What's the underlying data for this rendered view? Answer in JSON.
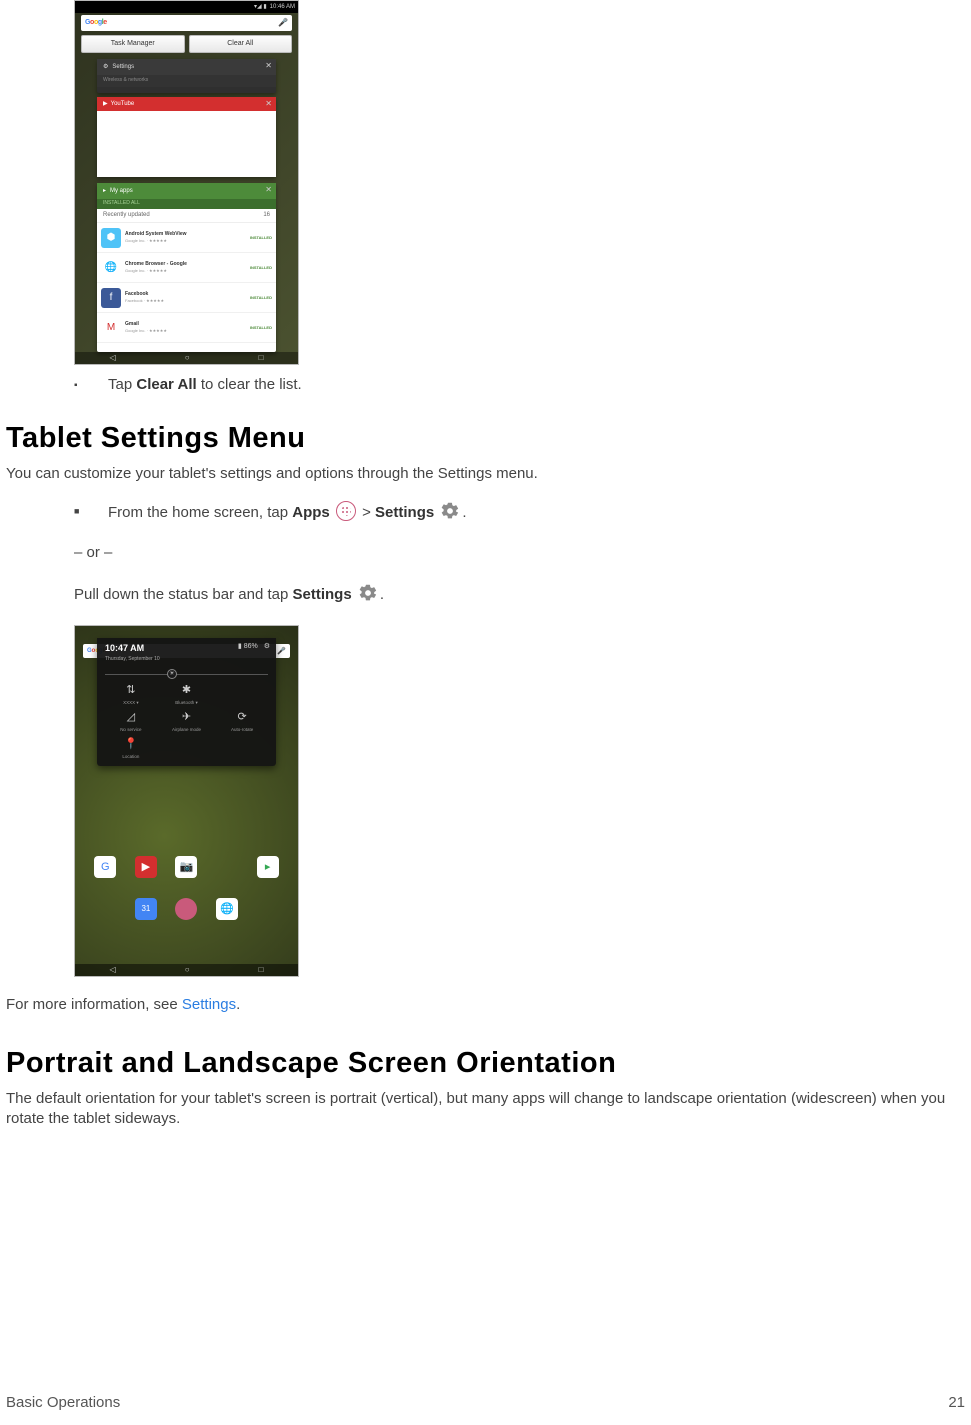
{
  "shot1": {
    "status_time": "10:46 AM",
    "status_signal": "▾◢ ▮",
    "btn_task_manager": "Task Manager",
    "btn_clear_all": "Clear All",
    "settings_label": "Settings",
    "settings_sub": "Wireless & networks",
    "youtube_label": "YouTube",
    "myapps_label": "My apps",
    "myapps_tab": "INSTALLED    ALL",
    "section_label": "Recently updated",
    "section_count": "16",
    "apps": [
      {
        "name": "Android System WebView",
        "meta": "Google Inc. · ★★★★★",
        "btn": "INSTALLED"
      },
      {
        "name": "Chrome Browser - Google",
        "meta": "Google Inc. · ★★★★★",
        "btn": "INSTALLED"
      },
      {
        "name": "Facebook",
        "meta": "Facebook · ★★★★★",
        "btn": "INSTALLED"
      },
      {
        "name": "Gmail",
        "meta": "Google Inc. · ★★★★★",
        "btn": "INSTALLED"
      }
    ]
  },
  "bullet1_pre": "Tap ",
  "bullet1_bold": "Clear All",
  "bullet1_post": " to clear the list.",
  "h1": "Tablet Settings Menu",
  "p1": "You can customize your tablet's settings and options through the Settings menu.",
  "bullet2": {
    "pre": "From the home screen, tap ",
    "apps": "Apps",
    "gt": " > ",
    "settings": "Settings",
    "post": "."
  },
  "or_line": "– or –",
  "pull_line_pre": "Pull down the status bar and tap ",
  "pull_line_bold": "Settings",
  "pull_line_post": ".",
  "shot2": {
    "time": "10:47 AM",
    "date": "Thursday, September 10",
    "battery_pct": "▮ 86%",
    "tiles": [
      {
        "icon": "⇅",
        "label": "XXXX ▾"
      },
      {
        "icon": "✱",
        "label": "Bluetooth ▾"
      },
      {
        "icon": "",
        "label": ""
      },
      {
        "icon": "◿",
        "label": "No service"
      },
      {
        "icon": "✈",
        "label": "Airplane mode"
      },
      {
        "icon": "⟳",
        "label": "Auto-rotate"
      },
      {
        "icon": "📍",
        "label": "Location"
      },
      {
        "icon": "",
        "label": ""
      },
      {
        "icon": "",
        "label": ""
      }
    ]
  },
  "more_info_pre": "For more information, see ",
  "more_info_link": "Settings",
  "more_info_post": ".",
  "h2": "Portrait and Landscape Screen Orientation",
  "p2": "The default orientation for your tablet's screen is portrait (vertical), but many apps will change to landscape orientation (widescreen) when you rotate the tablet sideways.",
  "footer_left": "Basic Operations",
  "footer_right": "21"
}
